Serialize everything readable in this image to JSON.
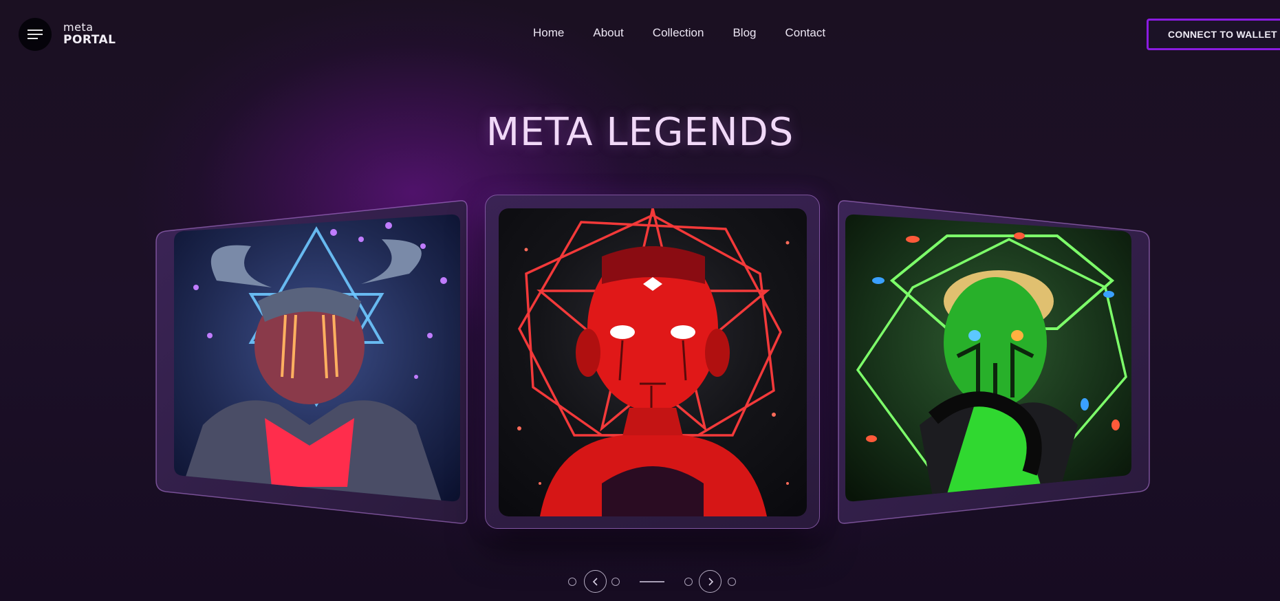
{
  "header": {
    "menu_icon": "hamburger-menu-icon",
    "logo_line1": "meta",
    "logo_line2": "PORTAL",
    "nav": [
      "Home",
      "About",
      "Collection",
      "Blog",
      "Contact"
    ],
    "wallet_button": "CONNECT TO WALLET"
  },
  "hero": {
    "title": "META LEGENDS"
  },
  "carousel": {
    "cards": [
      {
        "name": "blue demon avatar",
        "accent": "#3a8fff"
      },
      {
        "name": "red android avatar",
        "accent": "#ff2a2a"
      },
      {
        "name": "green reptile avatar",
        "accent": "#38ff3a"
      }
    ],
    "prev_icon": "chevron-left-icon",
    "next_icon": "chevron-right-icon"
  },
  "colors": {
    "background": "#1a0f24",
    "accent_purple": "#8a1be0",
    "title": "#f1d9f8"
  }
}
